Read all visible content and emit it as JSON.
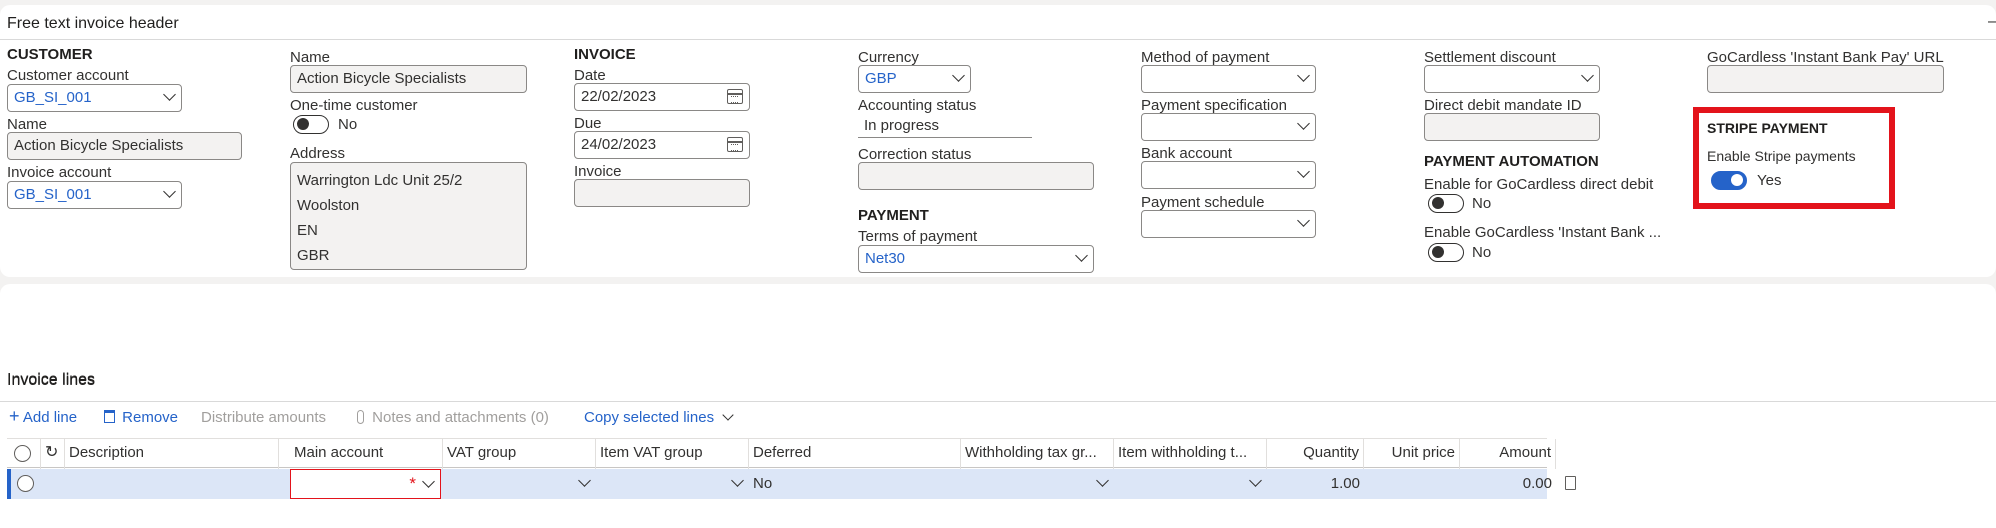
{
  "header_card": {
    "title": "Free text invoice header",
    "collapse_glyph": "–"
  },
  "customer": {
    "section": "CUSTOMER",
    "account_label": "Customer account",
    "account_value": "GB_SI_001",
    "name_label": "Name",
    "name_value": "Action Bicycle Specialists",
    "invoice_account_label": "Invoice account",
    "invoice_account_value": "GB_SI_001"
  },
  "party": {
    "name_label": "Name",
    "name_value": "Action Bicycle Specialists",
    "one_time_label": "One-time customer",
    "one_time_value": "No",
    "address_label": "Address",
    "address_lines": [
      "Warrington Ldc Unit 25/2",
      "Woolston",
      "EN",
      "GBR"
    ]
  },
  "invoice": {
    "section": "INVOICE",
    "date_label": "Date",
    "date_value": "22/02/2023",
    "due_label": "Due",
    "due_value": "24/02/2023",
    "invoice_label": "Invoice",
    "invoice_value": ""
  },
  "currency": {
    "currency_label": "Currency",
    "currency_value": "GBP",
    "accounting_status_label": "Accounting status",
    "accounting_status_value": "In progress",
    "correction_status_label": "Correction status",
    "correction_status_value": ""
  },
  "payment": {
    "section": "PAYMENT",
    "terms_label": "Terms of payment",
    "terms_value": "Net30"
  },
  "method": {
    "method_label": "Method of payment",
    "spec_label": "Payment specification",
    "bank_label": "Bank account",
    "schedule_label": "Payment schedule"
  },
  "settlement": {
    "discount_label": "Settlement discount",
    "mandate_label": "Direct debit mandate ID"
  },
  "automation": {
    "section": "PAYMENT AUTOMATION",
    "gocardless_dd_label": "Enable for GoCardless direct debit",
    "gocardless_dd_value": "No",
    "gocardless_iba_label": "Enable GoCardless 'Instant Bank ...",
    "gocardless_iba_value": "No"
  },
  "gocardless_url": {
    "label": "GoCardless 'Instant Bank Pay' URL",
    "value": ""
  },
  "stripe": {
    "section": "STRIPE PAYMENT",
    "enable_label": "Enable Stripe payments",
    "enable_value": "Yes",
    "enabled": true,
    "highlight_color": "#e3131b"
  },
  "lines_card": {
    "title": "Invoice lines"
  },
  "toolbar": {
    "add_line": "Add line",
    "remove": "Remove",
    "distribute": "Distribute amounts",
    "notes": "Notes and attachments (0)",
    "copy": "Copy selected lines"
  },
  "grid": {
    "columns": [
      "Description",
      "Main account",
      "VAT group",
      "Item VAT group",
      "Deferred",
      "Withholding tax gr...",
      "Item withholding t...",
      "Quantity",
      "Unit price",
      "Amount"
    ],
    "rows": [
      {
        "description": "",
        "main_account": "",
        "required_mark": "*",
        "vat_group": "",
        "item_vat_group": "",
        "deferred": "No",
        "withholding": "",
        "item_withholding": "",
        "quantity": "1.00",
        "unit_price": "",
        "amount": "0.00"
      }
    ]
  },
  "colors": {
    "accent": "#2563c9",
    "highlight": "#e3131b",
    "selected_row": "#dce6f7"
  }
}
